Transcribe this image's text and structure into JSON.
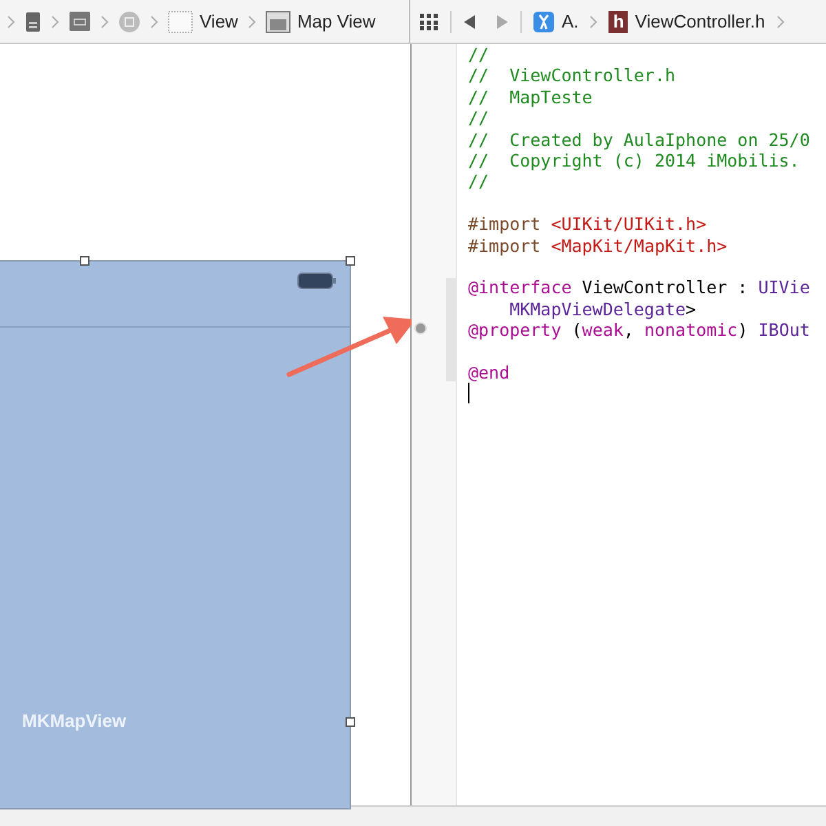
{
  "left_breadcrumb": [
    {
      "kind": "file"
    },
    {
      "kind": "scene"
    },
    {
      "kind": "controller"
    },
    {
      "kind": "view",
      "label": "View"
    },
    {
      "kind": "map",
      "label": "Map View"
    }
  ],
  "right_jumpbar": {
    "app_label": "A.",
    "file_badge": "h",
    "file_label": "ViewController.h"
  },
  "canvas": {
    "map_view_label": "MKMapView"
  },
  "code_lines": [
    {
      "tokens": [
        {
          "kind": "comment",
          "text": "//"
        }
      ]
    },
    {
      "tokens": [
        {
          "kind": "comment",
          "text": "//  ViewController.h"
        }
      ]
    },
    {
      "tokens": [
        {
          "kind": "comment",
          "text": "//  MapTeste"
        }
      ]
    },
    {
      "tokens": [
        {
          "kind": "comment",
          "text": "//"
        }
      ]
    },
    {
      "tokens": [
        {
          "kind": "comment",
          "text": "//  Created by AulaIphone on 25/0"
        }
      ]
    },
    {
      "tokens": [
        {
          "kind": "comment",
          "text": "//  Copyright (c) 2014 iMobilis."
        }
      ]
    },
    {
      "tokens": [
        {
          "kind": "comment",
          "text": "//"
        }
      ]
    },
    {
      "kind": "blank"
    },
    {
      "tokens": [
        {
          "kind": "directive",
          "text": "#import "
        },
        {
          "kind": "string",
          "text": "<UIKit/UIKit.h>"
        }
      ]
    },
    {
      "tokens": [
        {
          "kind": "directive",
          "text": "#import "
        },
        {
          "kind": "string",
          "text": "<MapKit/MapKit.h>"
        }
      ]
    },
    {
      "kind": "blank"
    },
    {
      "tokens": [
        {
          "kind": "keyword",
          "text": "@interface"
        },
        {
          "kind": "plain",
          "text": " ViewController : "
        },
        {
          "kind": "type",
          "text": "UIVie"
        }
      ]
    },
    {
      "tokens": [
        {
          "kind": "type",
          "text": "    MKMapViewDelegate"
        },
        {
          "kind": "plain",
          "text": ">"
        }
      ]
    },
    {
      "tokens": [
        {
          "kind": "keyword",
          "text": "@property"
        },
        {
          "kind": "plain",
          "text": " ("
        },
        {
          "kind": "keyword",
          "text": "weak"
        },
        {
          "kind": "plain",
          "text": ", "
        },
        {
          "kind": "keyword",
          "text": "nonatomic"
        },
        {
          "kind": "plain",
          "text": ") "
        },
        {
          "kind": "type",
          "text": "IBOut"
        }
      ]
    },
    {
      "kind": "blank"
    },
    {
      "tokens": [
        {
          "kind": "keyword",
          "text": "@end"
        }
      ]
    }
  ]
}
